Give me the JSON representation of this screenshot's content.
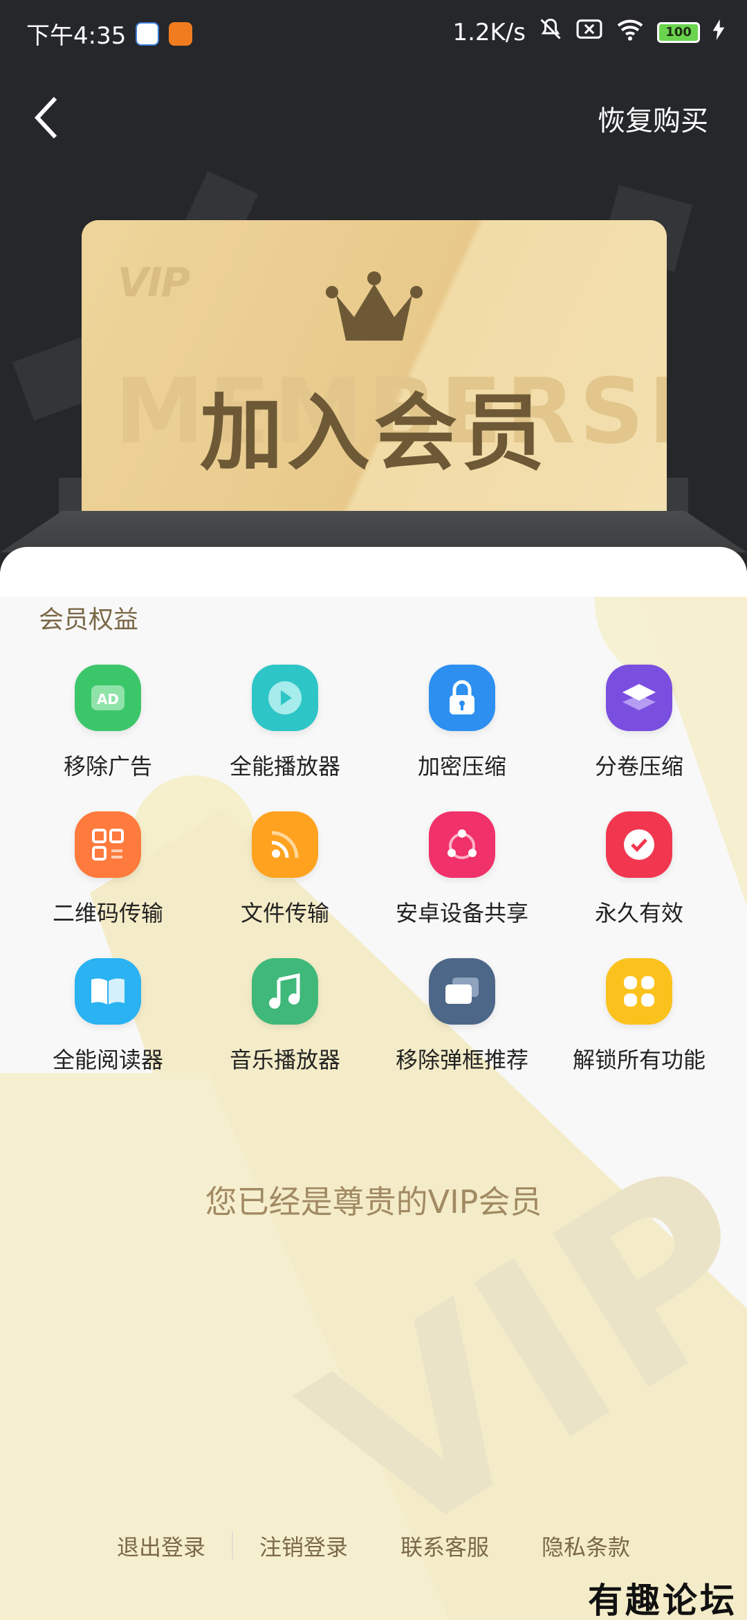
{
  "status_bar": {
    "time": "下午4:35",
    "network_speed": "1.2K/s",
    "battery": "100"
  },
  "nav": {
    "restore_label": "恢复购买"
  },
  "card": {
    "vip_tag": "VIP",
    "watermark": "MEMBERSHIP",
    "title": "加入会员"
  },
  "benefits": {
    "section_title": "会员权益",
    "items": [
      {
        "label": "移除广告",
        "icon": "ad-icon",
        "color": "#3cc66a"
      },
      {
        "label": "全能播放器",
        "icon": "play-icon",
        "color": "#2ec5c7"
      },
      {
        "label": "加密压缩",
        "icon": "lock-icon",
        "color": "#2d8ff0"
      },
      {
        "label": "分卷压缩",
        "icon": "layers-icon",
        "color": "#7a4fe0"
      },
      {
        "label": "二维码传输",
        "icon": "qrcode-icon",
        "color": "#ff7a3d"
      },
      {
        "label": "文件传输",
        "icon": "feed-icon",
        "color": "#ffa21f"
      },
      {
        "label": "安卓设备共享",
        "icon": "share-icon",
        "color": "#f0316a"
      },
      {
        "label": "永久有效",
        "icon": "check-icon",
        "color": "#f0374f"
      },
      {
        "label": "全能阅读器",
        "icon": "book-icon",
        "color": "#2ab2f2"
      },
      {
        "label": "音乐播放器",
        "icon": "music-icon",
        "color": "#3fb87a"
      },
      {
        "label": "移除弹框推荐",
        "icon": "window-icon",
        "color": "#4d6788"
      },
      {
        "label": "解锁所有功能",
        "icon": "grid-icon",
        "color": "#fbc21e"
      }
    ]
  },
  "vip_status": "您已经是尊贵的VIP会员",
  "footer": {
    "logout": "退出登录",
    "deregister": "注销登录",
    "contact": "联系客服",
    "privacy": "隐私条款"
  },
  "watermark_logo": "有趣论坛"
}
